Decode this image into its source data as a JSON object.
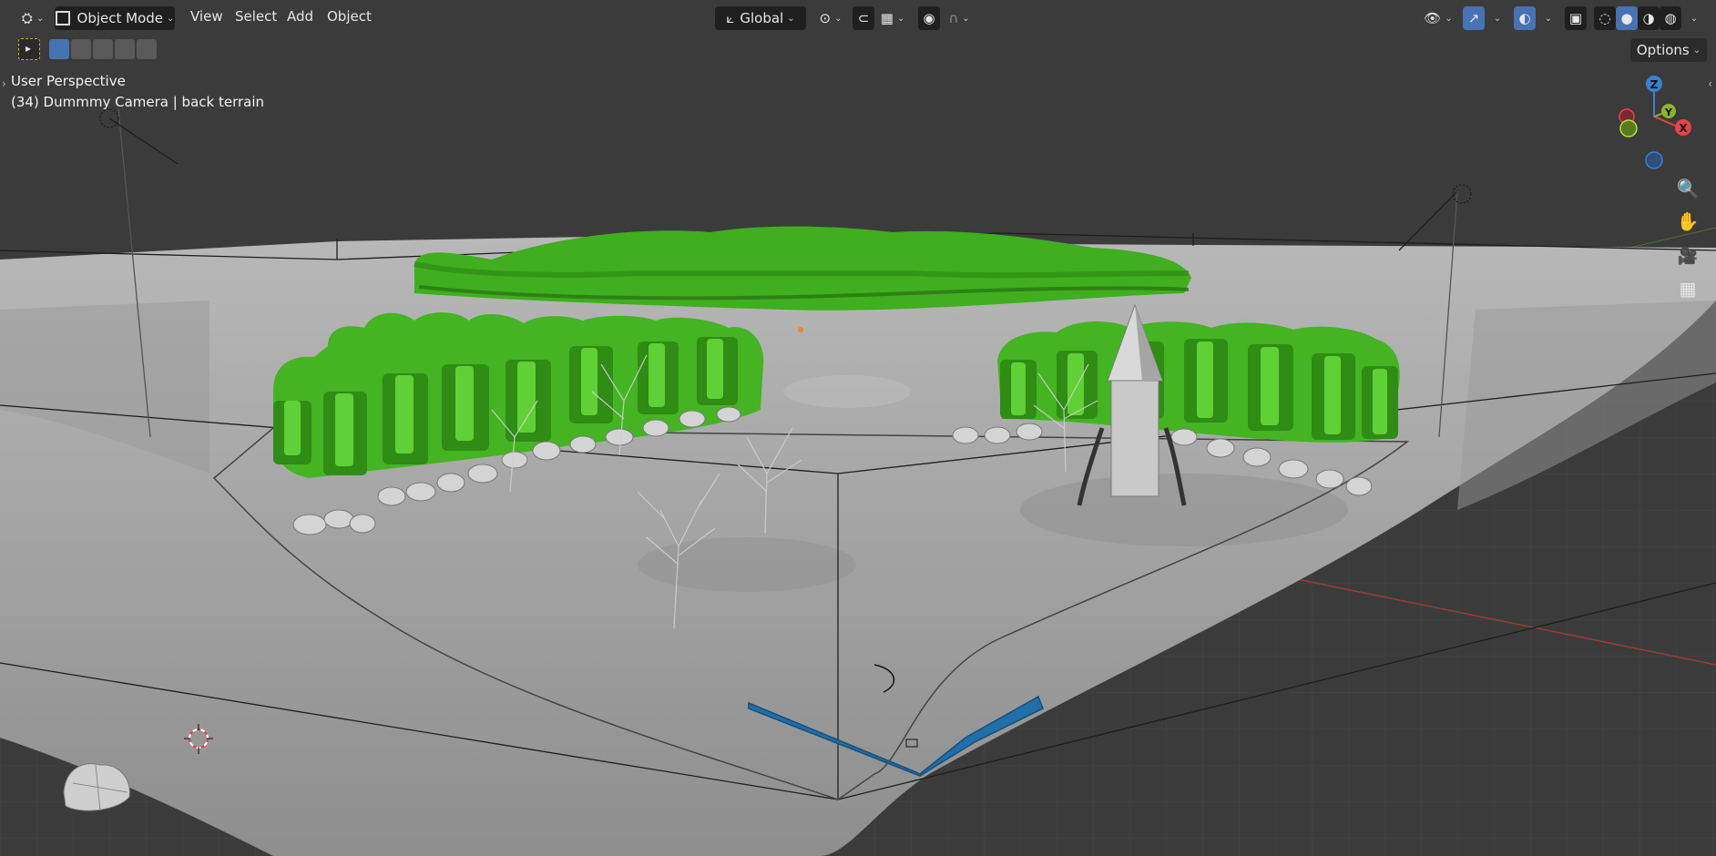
{
  "header": {
    "editor_type_icon": "view3d-icon",
    "mode_label": "Object Mode",
    "menus": [
      "View",
      "Select",
      "Add",
      "Object"
    ],
    "transform_orientation": "Global",
    "options_label": "Options"
  },
  "overlay": {
    "view_name": "User Perspective",
    "object_info": "(34) Dummmy Camera | back terrain"
  },
  "gizmo": {
    "z_label": "Z",
    "y_label": "Y",
    "x_label": "X"
  },
  "colors": {
    "background": "#3d3d3d",
    "header": "#303030",
    "accent_blue": "#4772b3",
    "axis_x": "#e8434a",
    "axis_y": "#8ab52d",
    "axis_z": "#3a7fd0",
    "terrain": "#a9a9a9",
    "trees": "#4fbf2a",
    "water": "#1f6fa8"
  },
  "icons": [
    "transform-orientation-icon",
    "pivot-icon",
    "snap-icon",
    "snap-grid-icon",
    "proportional-edit-icon",
    "falloff-icon",
    "visibility-icon",
    "gizmo-icon",
    "overlay-icon",
    "xray-icon",
    "wireframe-shading-icon",
    "solid-shading-icon",
    "material-shading-icon",
    "rendered-shading-icon",
    "zoom-icon",
    "pan-hand-icon",
    "camera-view-icon",
    "perspective-grid-icon"
  ]
}
